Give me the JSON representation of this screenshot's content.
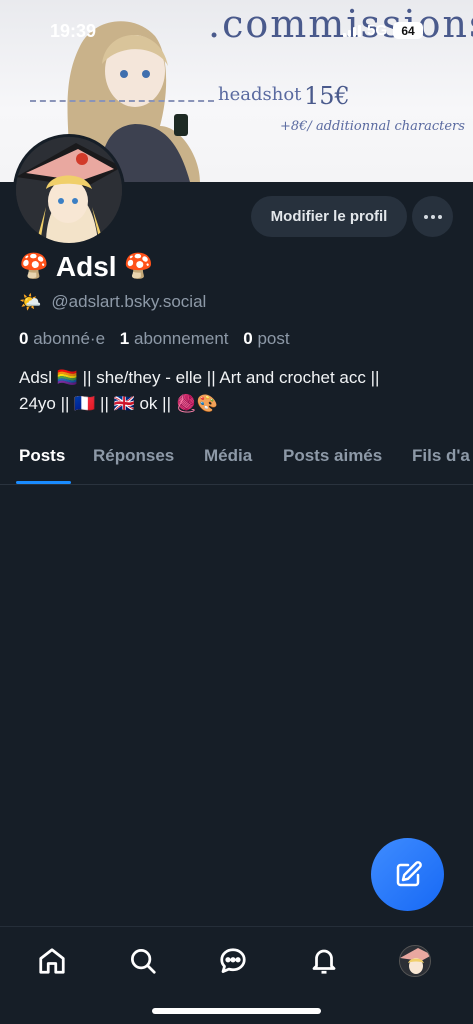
{
  "status_bar": {
    "time": "19:39",
    "network": "5G",
    "battery": "64"
  },
  "banner": {
    "title": ".commissions•",
    "headshot_label": "headshot",
    "headshot_price": "15€",
    "extra_characters": "+8€/ additionnal characters"
  },
  "profile": {
    "edit_label": "Modifier le profil",
    "display_name": "Adsl",
    "name_emoji": "🍄",
    "handle_emoji": "🌤️",
    "handle": "@adslart.bsky.social",
    "followers_count": "0",
    "followers_label": "abonné·e",
    "following_count": "1",
    "following_label": "abonnement",
    "posts_count": "0",
    "posts_label": "post",
    "bio_line1": "Adsl 🏳️‍🌈 || she/they - elle || Art and crochet acc ||",
    "bio_line2": "24yo || 🇫🇷 || 🇬🇧 ok || 🧶🎨"
  },
  "tabs": [
    {
      "label": "Posts",
      "active": true
    },
    {
      "label": "Réponses",
      "active": false
    },
    {
      "label": "Média",
      "active": false
    },
    {
      "label": "Posts aimés",
      "active": false
    },
    {
      "label": "Fils d'a",
      "active": false
    }
  ],
  "colors": {
    "background": "#161e27",
    "accent": "#1a8cff",
    "fab": "#2f7bff"
  },
  "icons": {
    "fab": "compose-icon",
    "nav": [
      "home-icon",
      "search-icon",
      "chat-icon",
      "bell-icon",
      "profile-avatar"
    ]
  }
}
